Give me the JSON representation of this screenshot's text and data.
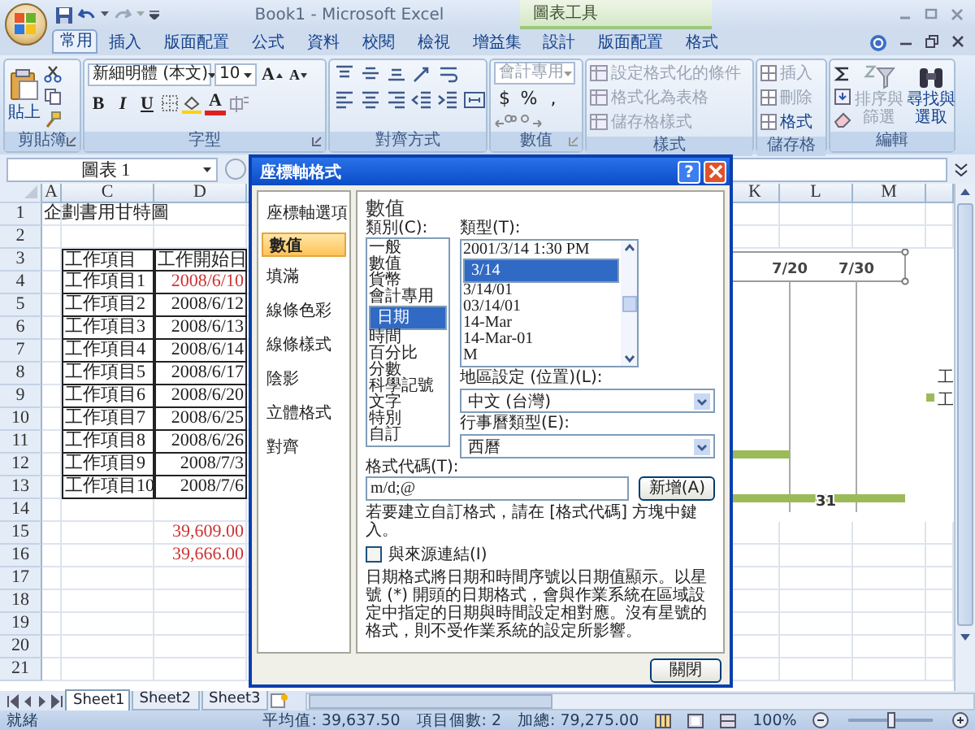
{
  "window": {
    "title": "Book1 - Microsoft Excel",
    "context_group": "圖表工具"
  },
  "tabs": [
    {
      "label": "常用",
      "selected": true,
      "kind": "main"
    },
    {
      "label": "插入",
      "selected": false,
      "kind": "main"
    },
    {
      "label": "版面配置",
      "selected": false,
      "kind": "main"
    },
    {
      "label": "公式",
      "selected": false,
      "kind": "main"
    },
    {
      "label": "資料",
      "selected": false,
      "kind": "main"
    },
    {
      "label": "校閱",
      "selected": false,
      "kind": "main"
    },
    {
      "label": "檢視",
      "selected": false,
      "kind": "main"
    },
    {
      "label": "增益集",
      "selected": false,
      "kind": "main"
    },
    {
      "label": "設計",
      "selected": false,
      "kind": "context"
    },
    {
      "label": "版面配置",
      "selected": false,
      "kind": "context"
    },
    {
      "label": "格式",
      "selected": false,
      "kind": "context"
    }
  ],
  "ribbon": {
    "clipboard": {
      "label": "剪貼簿",
      "paste": "貼上"
    },
    "font": {
      "label": "字型",
      "font_name": "新細明體 (本文)",
      "font_size": "10",
      "grow": "A",
      "shrink": "A",
      "bold": "B",
      "italic": "I",
      "underline": "U",
      "font_color": "A"
    },
    "alignment": {
      "label": "對齊方式"
    },
    "number": {
      "label": "數值",
      "format": "會計專用",
      "currency": "$",
      "percent": "%",
      "comma": ",",
      "disabled": true
    },
    "styles": {
      "label": "樣式",
      "items": [
        {
          "label": "設定格式化的條件",
          "disabled": true
        },
        {
          "label": "格式化為表格",
          "disabled": true
        },
        {
          "label": "儲存格樣式",
          "disabled": true
        }
      ]
    },
    "cells": {
      "label": "儲存格",
      "items": [
        {
          "label": "插入",
          "disabled": true
        },
        {
          "label": "刪除",
          "disabled": true
        },
        {
          "label": "格式",
          "disabled": false
        }
      ]
    },
    "editing": {
      "label": "編輯",
      "sort": {
        "label": "排序與篩選",
        "disabled": true
      },
      "find": {
        "label": "尋找與選取",
        "disabled": false
      }
    }
  },
  "formula_bar": {
    "name_box": "圖表 1"
  },
  "sheet": {
    "columns": [
      "A",
      "C",
      "D",
      "K",
      "L",
      "M"
    ],
    "rows": [
      {
        "number": "1",
        "a": "企劃書用甘特圖",
        "boxed": false
      },
      {
        "number": "2",
        "boxed": false
      },
      {
        "number": "3",
        "c": "工作項目",
        "d": {
          "text": "工作開始日"
        },
        "boxed": true
      },
      {
        "number": "4",
        "c": "工作項目1",
        "d": {
          "text": "2008/6/10",
          "color": "#cc3333"
        },
        "boxed": true
      },
      {
        "number": "5",
        "c": "工作項目2",
        "d": {
          "text": "2008/6/12"
        },
        "boxed": true
      },
      {
        "number": "6",
        "c": "工作項目3",
        "d": {
          "text": "2008/6/13"
        },
        "boxed": true
      },
      {
        "number": "7",
        "c": "工作項目4",
        "d": {
          "text": "2008/6/14"
        },
        "boxed": true
      },
      {
        "number": "8",
        "c": "工作項目5",
        "d": {
          "text": "2008/6/17"
        },
        "boxed": true
      },
      {
        "number": "9",
        "c": "工作項目6",
        "d": {
          "text": "2008/6/20"
        },
        "boxed": true
      },
      {
        "number": "10",
        "c": "工作項目7",
        "d": {
          "text": "2008/6/25"
        },
        "boxed": true
      },
      {
        "number": "11",
        "c": "工作項目8",
        "d": {
          "text": "2008/6/26"
        },
        "boxed": true
      },
      {
        "number": "12",
        "c": "工作項目9",
        "d": {
          "text": "2008/7/3"
        },
        "boxed": true
      },
      {
        "number": "13",
        "c": "工作項目10",
        "d": {
          "text": "2008/7/6"
        },
        "boxed": true
      },
      {
        "number": "14",
        "boxed": false
      },
      {
        "number": "15",
        "d": {
          "text": "39,609.00",
          "color": "#cc3333"
        },
        "boxed": false
      },
      {
        "number": "16",
        "d": {
          "text": "39,666.00",
          "color": "#cc3333"
        },
        "boxed": false
      },
      {
        "number": "17",
        "boxed": false
      },
      {
        "number": "18",
        "boxed": false
      },
      {
        "number": "19",
        "boxed": false
      },
      {
        "number": "20",
        "boxed": false
      },
      {
        "number": "21",
        "boxed": false
      }
    ]
  },
  "chart": {
    "axis_labels": [
      "7/20",
      "7/30"
    ],
    "bar_label": "31",
    "legend": [
      {
        "label": "工"
      },
      {
        "label": "工",
        "color": "#9bbb59"
      }
    ]
  },
  "dialog": {
    "title": "座標軸格式",
    "help_button": "?",
    "nav": [
      {
        "label": "座標軸選項",
        "selected": false
      },
      {
        "label": "數值",
        "selected": true
      },
      {
        "label": "填滿",
        "selected": false
      },
      {
        "label": "線條色彩",
        "selected": false
      },
      {
        "label": "線條樣式",
        "selected": false
      },
      {
        "label": "陰影",
        "selected": false
      },
      {
        "label": "立體格式",
        "selected": false
      },
      {
        "label": "對齊",
        "selected": false
      }
    ],
    "heading": "數值",
    "category_label": "類別(C):",
    "categories": [
      {
        "label": "一般",
        "selected": false
      },
      {
        "label": "數值",
        "selected": false
      },
      {
        "label": "貨幣",
        "selected": false
      },
      {
        "label": "會計專用",
        "selected": false
      },
      {
        "label": "日期",
        "selected": true
      },
      {
        "label": "時間",
        "selected": false
      },
      {
        "label": "百分比",
        "selected": false
      },
      {
        "label": "分數",
        "selected": false
      },
      {
        "label": "科學記號",
        "selected": false
      },
      {
        "label": "文字",
        "selected": false
      },
      {
        "label": "特別",
        "selected": false
      },
      {
        "label": "自訂",
        "selected": false
      }
    ],
    "type_label": "類型(T):",
    "types": [
      {
        "label": "2001/3/14 1:30 PM",
        "selected": false
      },
      {
        "label": "3/14",
        "selected": true
      },
      {
        "label": "3/14/01",
        "selected": false
      },
      {
        "label": "03/14/01",
        "selected": false
      },
      {
        "label": "14-Mar",
        "selected": false
      },
      {
        "label": "14-Mar-01",
        "selected": false
      },
      {
        "label": "M",
        "selected": false
      }
    ],
    "locale_label": "地區設定 (位置)(L):",
    "locale": "中文 (台灣)",
    "calendar_label": "行事曆類型(E):",
    "calendar": "西曆",
    "format_code_label": "格式代碼(T):",
    "format_code": "m/d;@",
    "add_button": "新增(A)",
    "hint": "若要建立自訂格式，請在 [格式代碼] 方塊中鍵入。",
    "link_source": {
      "label": "與來源連結(I)",
      "checked": false
    },
    "description": "日期格式將日期和時間序號以日期值顯示。以星號 (*) 開頭的日期格式，會與作業系統在區域設定中指定的日期與時間設定相對應。沒有星號的格式，則不受作業系統的設定所影響。",
    "close_button": "關閉"
  },
  "sheet_tabs": [
    {
      "label": "Sheet1",
      "selected": true
    },
    {
      "label": "Sheet2",
      "selected": false
    },
    {
      "label": "Sheet3",
      "selected": false
    }
  ],
  "status_bar": {
    "ready": "就緒",
    "average": "平均值: 39,637.50",
    "count": "項目個數: 2",
    "sum": "加總: 79,275.00",
    "zoom": "100%",
    "zoom_slider": {
      "level": 0.5
    }
  }
}
